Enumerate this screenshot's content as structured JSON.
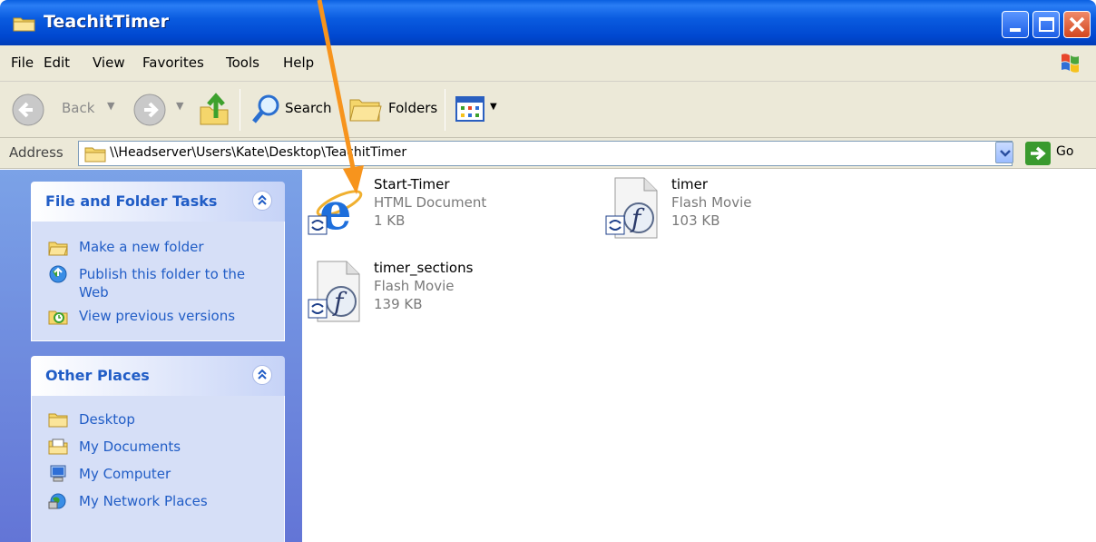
{
  "window": {
    "title": "TeachitTimer"
  },
  "menu": {
    "items": [
      "File",
      "Edit",
      "View",
      "Favorites",
      "Tools",
      "Help"
    ]
  },
  "toolbar": {
    "back_label": "Back",
    "search_label": "Search",
    "folders_label": "Folders"
  },
  "address": {
    "label": "Address",
    "value": "\\\\Headserver\\Users\\Kate\\Desktop\\TeachitTimer",
    "go_label": "Go"
  },
  "tasks_panel": {
    "title": "File and Folder Tasks",
    "items": [
      {
        "label": "Make a new folder",
        "icon": "new-folder-icon"
      },
      {
        "label": "Publish this folder to the Web",
        "icon": "publish-web-icon"
      },
      {
        "label": "View previous versions",
        "icon": "previous-versions-icon"
      }
    ]
  },
  "places_panel": {
    "title": "Other Places",
    "items": [
      {
        "label": "Desktop",
        "icon": "desktop-folder-icon"
      },
      {
        "label": "My Documents",
        "icon": "my-documents-icon"
      },
      {
        "label": "My Computer",
        "icon": "my-computer-icon"
      },
      {
        "label": "My Network Places",
        "icon": "network-places-icon"
      }
    ]
  },
  "files": [
    {
      "name": "Start-Timer",
      "type": "HTML Document",
      "size": "1 KB",
      "icon": "internet-explorer-html-icon"
    },
    {
      "name": "timer",
      "type": "Flash Movie",
      "size": "103 KB",
      "icon": "flash-movie-icon"
    },
    {
      "name": "timer_sections",
      "type": "Flash Movie",
      "size": "139 KB",
      "icon": "flash-movie-icon"
    }
  ],
  "colors": {
    "titlebar": "#0a5ce0",
    "taskpane": "#6f8ddf",
    "link": "#215dc6",
    "annotation_arrow": "#f7941d"
  }
}
